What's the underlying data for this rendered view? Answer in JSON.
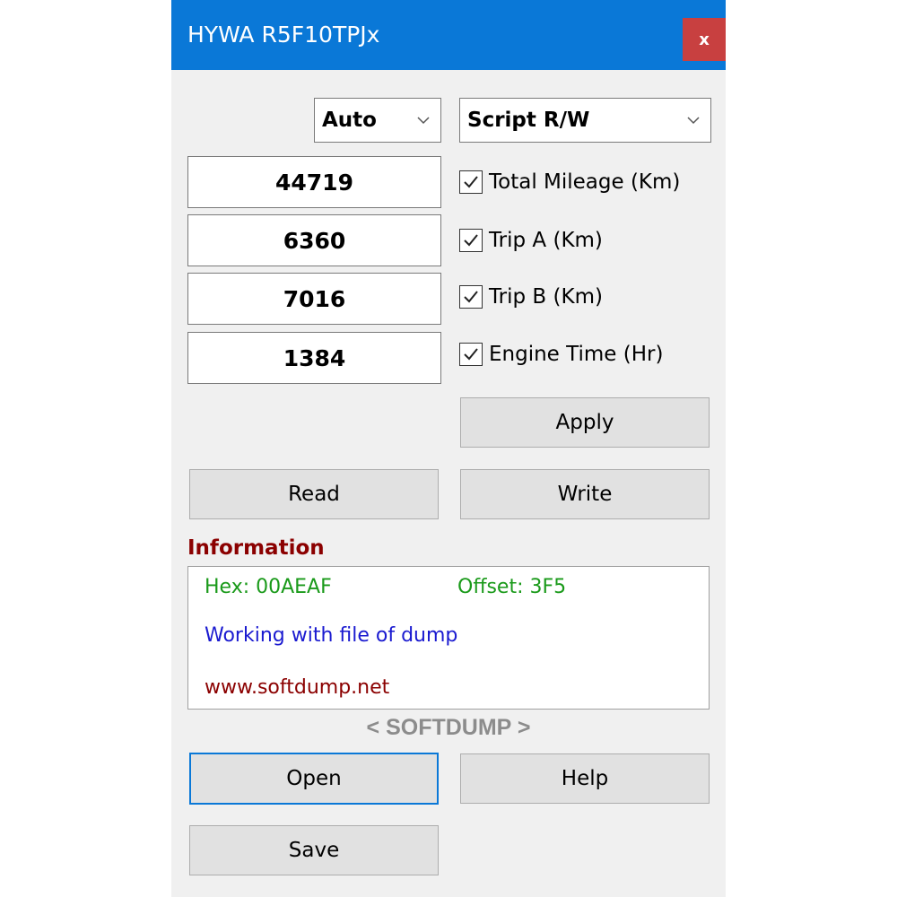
{
  "window": {
    "title": "HYWA R5F10TPJx",
    "close_label": "x"
  },
  "selects": {
    "mode": "Auto",
    "script": "Script R/W"
  },
  "fields": [
    {
      "value": "44719",
      "label": "Total Mileage (Km)",
      "checked": true
    },
    {
      "value": "6360",
      "label": "Trip A (Km)",
      "checked": true
    },
    {
      "value": "7016",
      "label": "Trip B (Km)",
      "checked": true
    },
    {
      "value": "1384",
      "label": "Engine Time (Hr)",
      "checked": true
    }
  ],
  "buttons": {
    "apply": "Apply",
    "read": "Read",
    "write": "Write",
    "open": "Open",
    "help": "Help",
    "save": "Save"
  },
  "info": {
    "title": "Information",
    "hex": "Hex: 00AEAF",
    "offset": "Offset: 3F5",
    "status": "Working with file of dump",
    "website": "www.softdump.net"
  },
  "brand": "< SOFTDUMP >",
  "colors": {
    "titlebar": "#0a78d7",
    "close": "#c84040",
    "info_title": "#8b0000",
    "hex_text": "#1a9a1a",
    "status_text": "#1a1ad0",
    "website_text": "#8b0000",
    "brand_text": "#8c8c8c"
  }
}
